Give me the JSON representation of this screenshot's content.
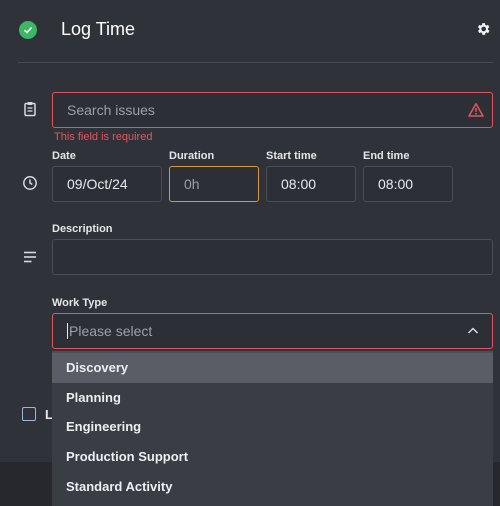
{
  "header": {
    "title": "Log Time"
  },
  "issue": {
    "placeholder": "Search issues",
    "error": "This field is required"
  },
  "time": {
    "date_label": "Date",
    "date_value": "09/Oct/24",
    "duration_label": "Duration",
    "duration_placeholder": "0h",
    "start_label": "Start time",
    "start_value": "08:00",
    "end_label": "End time",
    "end_value": "08:00"
  },
  "description": {
    "label": "Description",
    "value": ""
  },
  "work_type": {
    "label": "Work Type",
    "placeholder": "Please select",
    "options": [
      "Discovery",
      "Planning",
      "Engineering",
      "Production Support",
      "Standard Activity"
    ]
  },
  "behind": {
    "checkbox_letter": "L"
  },
  "colors": {
    "background": "#2f3239",
    "success": "#3cb765",
    "error": "#e0565e",
    "focus": "#d79a3a"
  },
  "icons": [
    "check-circle-icon",
    "gear-icon",
    "clipboard-icon",
    "warning-icon",
    "clock-icon",
    "text-lines-icon",
    "chevron-up-icon"
  ]
}
